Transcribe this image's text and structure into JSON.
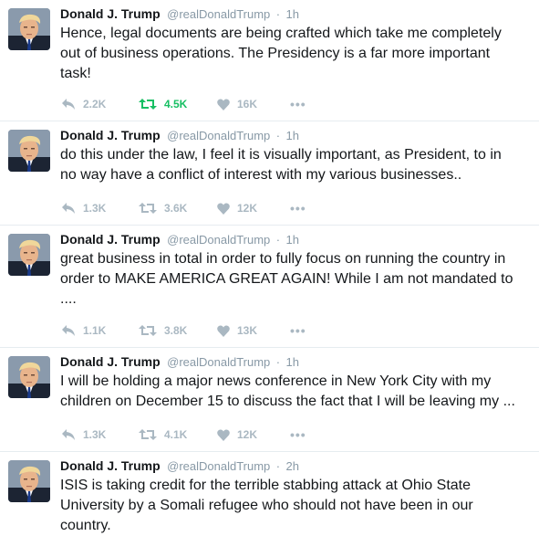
{
  "tweets": [
    {
      "name": "Donald J. Trump",
      "handle": "@realDonaldTrump",
      "time": "1h",
      "text": "Hence, legal documents are being crafted which take me completely out of business operations. The Presidency is a far more important task!",
      "replies": "2.2K",
      "retweets": "4.5K",
      "likes": "16K",
      "retweeted": true
    },
    {
      "name": "Donald J. Trump",
      "handle": "@realDonaldTrump",
      "time": "1h",
      "text": "do this under the law, I feel it is visually important, as President,  to in no way have a conflict of interest with my various businesses..",
      "replies": "1.3K",
      "retweets": "3.6K",
      "likes": "12K",
      "retweeted": false
    },
    {
      "name": "Donald J. Trump",
      "handle": "@realDonaldTrump",
      "time": "1h",
      "text": "great business in total in order to fully focus on running the country in order to MAKE AMERICA GREAT AGAIN! While I am not mandated to ....",
      "replies": "1.1K",
      "retweets": "3.8K",
      "likes": "13K",
      "retweeted": false
    },
    {
      "name": "Donald J. Trump",
      "handle": "@realDonaldTrump",
      "time": "1h",
      "text": "I will be holding a major news conference in New York City with my children on December 15 to discuss the fact that I will be leaving my ...",
      "replies": "1.3K",
      "retweets": "4.1K",
      "likes": "12K",
      "retweeted": false
    },
    {
      "name": "Donald J. Trump",
      "handle": "@realDonaldTrump",
      "time": "2h",
      "text": "ISIS is taking credit for the terrible stabbing attack at Ohio State University by a Somali refugee who should not have been in our country.",
      "replies": "",
      "retweets": "",
      "likes": "",
      "retweeted": false
    }
  ],
  "icons": {
    "reply": "reply-icon",
    "retweet": "retweet-icon",
    "like": "heart-icon",
    "more": "more-icon"
  },
  "colors": {
    "text": "#14171a",
    "muted": "#8899a6",
    "action_gray": "#aab8c2",
    "retweet_active": "#17bf63",
    "divider": "#e6ecf0"
  }
}
